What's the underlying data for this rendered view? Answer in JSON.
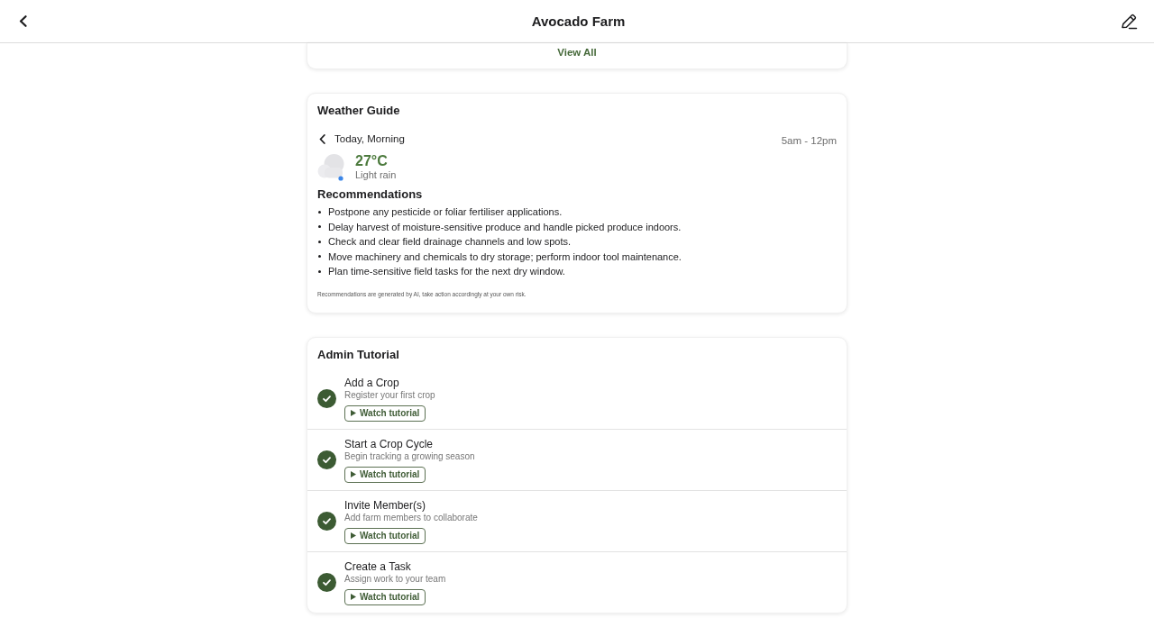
{
  "header": {
    "title": "Avocado Farm"
  },
  "previous_card": {
    "link": "View All"
  },
  "weather_guide": {
    "title": "Weather Guide",
    "period": "Today, Morning",
    "time_range": "5am - 12pm",
    "temperature": "27°C",
    "condition": "Light rain",
    "recommendations_title": "Recommendations",
    "recommendations": [
      "Postpone any pesticide or foliar fertiliser applications.",
      "Delay harvest of moisture-sensitive produce and handle picked produce indoors.",
      "Check and clear field drainage channels and low spots.",
      "Move machinery and chemicals to dry storage; perform indoor tool maintenance.",
      "Plan time-sensitive field tasks for the next dry window."
    ],
    "disclaimer": "Recommendations are generated by AI, take action accordingly at your own risk."
  },
  "admin_tutorial": {
    "title": "Admin Tutorial",
    "steps": [
      {
        "title": "Add a Crop",
        "description": "Register your first crop",
        "completed": true,
        "button": "Watch tutorial"
      },
      {
        "title": "Start a Crop Cycle",
        "description": "Begin tracking a growing season",
        "completed": true,
        "button": "Watch tutorial"
      },
      {
        "title": "Invite Member(s)",
        "description": "Add farm members to collaborate",
        "completed": true,
        "button": "Watch tutorial"
      },
      {
        "title": "Create a Task",
        "description": "Assign work to your team",
        "completed": true,
        "button": "Watch tutorial"
      }
    ]
  }
}
